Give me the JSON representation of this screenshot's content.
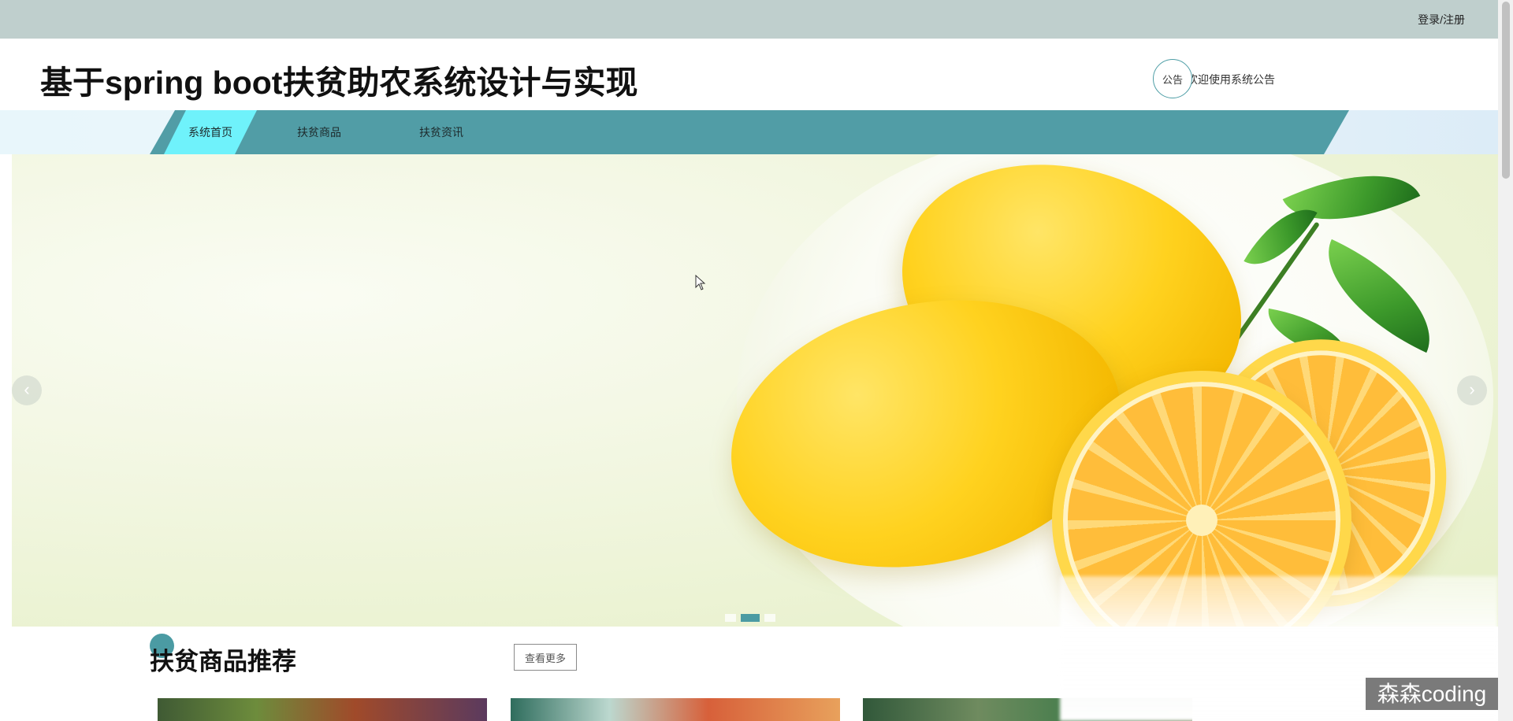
{
  "topbar": {
    "login_label": "登录/注册"
  },
  "header": {
    "site_title": "基于spring boot扶贫助农系统设计与实现",
    "notice_badge": "公告",
    "notice_text": "欢迎使用系统公告"
  },
  "nav": {
    "items": [
      {
        "label": "系统首页",
        "active": true
      },
      {
        "label": "扶贫商品",
        "active": false
      },
      {
        "label": "扶贫资讯",
        "active": false
      }
    ]
  },
  "banner": {
    "prev_arrow": "‹",
    "next_arrow": "›",
    "slides_count": 3,
    "active_slide": 2
  },
  "section": {
    "title": "扶贫商品推荐",
    "more_label": "查看更多"
  },
  "watermark": {
    "text": "森森coding"
  },
  "colors": {
    "topbar": "#bfcfcd",
    "nav_bar": "#519da6",
    "nav_active": "#6ff2fb",
    "accent": "#4b9ba3"
  },
  "icons": {
    "cursor": "mouse-pointer-icon",
    "prev": "chevron-left-icon",
    "next": "chevron-right-icon"
  }
}
